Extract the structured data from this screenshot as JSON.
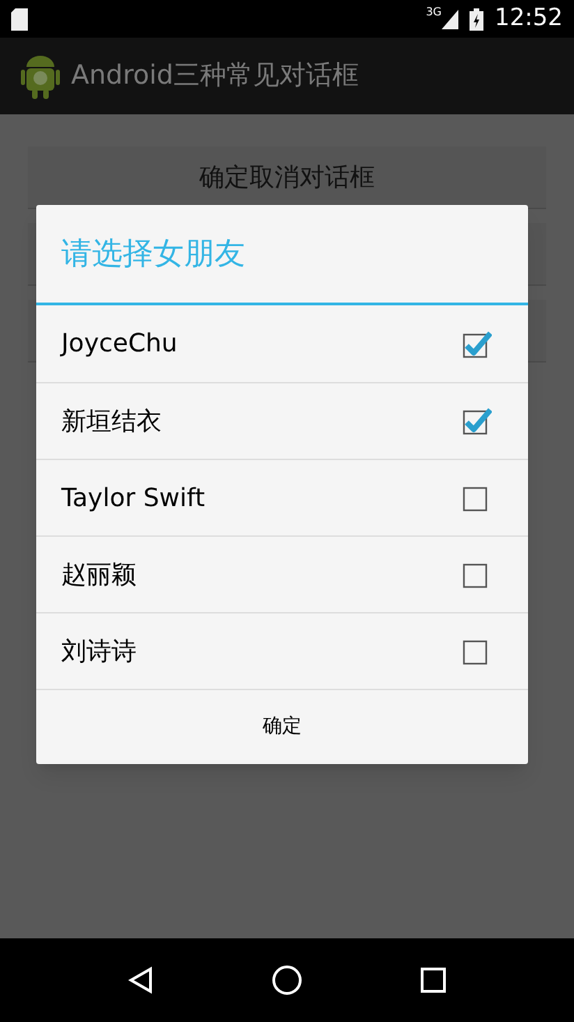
{
  "status_bar": {
    "network": "3G",
    "time": "12:52"
  },
  "action_bar": {
    "title": "Android三种常见对话框"
  },
  "background_buttons": [
    "确定取消对话框"
  ],
  "dialog": {
    "title": "请选择女朋友",
    "items": [
      {
        "label": "JoyceChu",
        "checked": true
      },
      {
        "label": "新垣结衣",
        "checked": true
      },
      {
        "label": "Taylor Swift",
        "checked": false
      },
      {
        "label": "赵丽颖",
        "checked": false
      },
      {
        "label": "刘诗诗",
        "checked": false
      }
    ],
    "button": "确定"
  }
}
